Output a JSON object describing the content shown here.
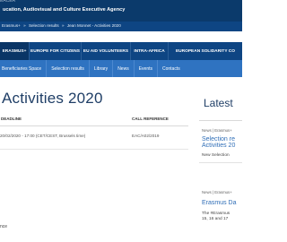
{
  "header": {
    "logo_text": "EACEA",
    "agency_title": "ucation, Audiovisual and Culture Executive Agency"
  },
  "breadcrumb": [
    "Erasmus+",
    "»",
    "Selection results",
    "»",
    "Jean Monnet - Activities 2020"
  ],
  "main_nav": [
    {
      "label": "ERASMUS+",
      "active": true
    },
    {
      "label": "EUROPE FOR CITIZENS",
      "active": false
    },
    {
      "label": "EU AID VOLUNTEERS",
      "active": false
    },
    {
      "label": "INTRA-AFRICA",
      "active": false
    },
    {
      "label": "EUROPEAN SOLIDARITY CO",
      "active": false
    }
  ],
  "sub_nav": [
    "Beneficiaries Space",
    "Selection results",
    "Library",
    "News",
    "Events",
    "Contacts"
  ],
  "page": {
    "title": "Activities 2020",
    "columns": {
      "deadline": "DEADLINE",
      "call_reference": "CALL REFERENCE"
    },
    "row": {
      "deadline": "20/02/2020 - 17:00 (CET/CEST, Brussels time)",
      "call_reference": "EAC/A02/2019"
    },
    "left_fragment": "nce"
  },
  "sidebar": {
    "title": "Latest",
    "items": [
      {
        "meta": "News | Erasmus+",
        "title_lines": [
          "Selection re",
          "Activities 20"
        ],
        "excerpt_lines": [
          "New Selection"
        ]
      },
      {
        "meta": "News | Erasmus+",
        "title_lines": [
          "Erasmus Da"
        ],
        "excerpt_lines": [
          "The #Erasmus",
          "15, 16 and 17"
        ]
      }
    ]
  }
}
